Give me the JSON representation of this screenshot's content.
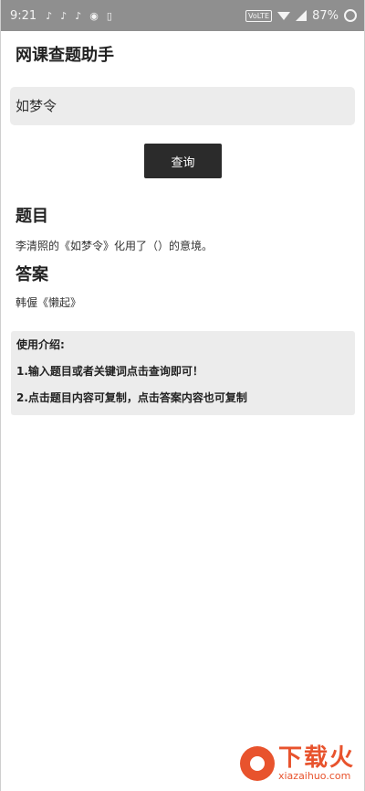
{
  "status_bar": {
    "time": "9:21",
    "notifications": [
      "♪",
      "♪",
      "♪",
      "◉",
      "▯"
    ],
    "volte": "VoLTE",
    "battery": "87%"
  },
  "app": {
    "title": "网课查题助手"
  },
  "search": {
    "value": "如梦令"
  },
  "query_button": {
    "label": "查询"
  },
  "question": {
    "heading": "题目",
    "text": "李清照的《如梦令》化用了（）的意境。"
  },
  "answer": {
    "heading": "答案",
    "text": "韩偓《懒起》"
  },
  "intro": {
    "title": "使用介绍:",
    "line1": "1.输入题目或者关键词点击查询即可！",
    "line2": "2.点击题目内容可复制，点击答案内容也可复制"
  },
  "watermark": {
    "name": "下载火",
    "url": "xiazaihuo.com"
  },
  "colors": {
    "status_bar": "#8f8f8f",
    "button": "#2b2b2b",
    "card": "#ececec",
    "brand": "#e8532d"
  }
}
